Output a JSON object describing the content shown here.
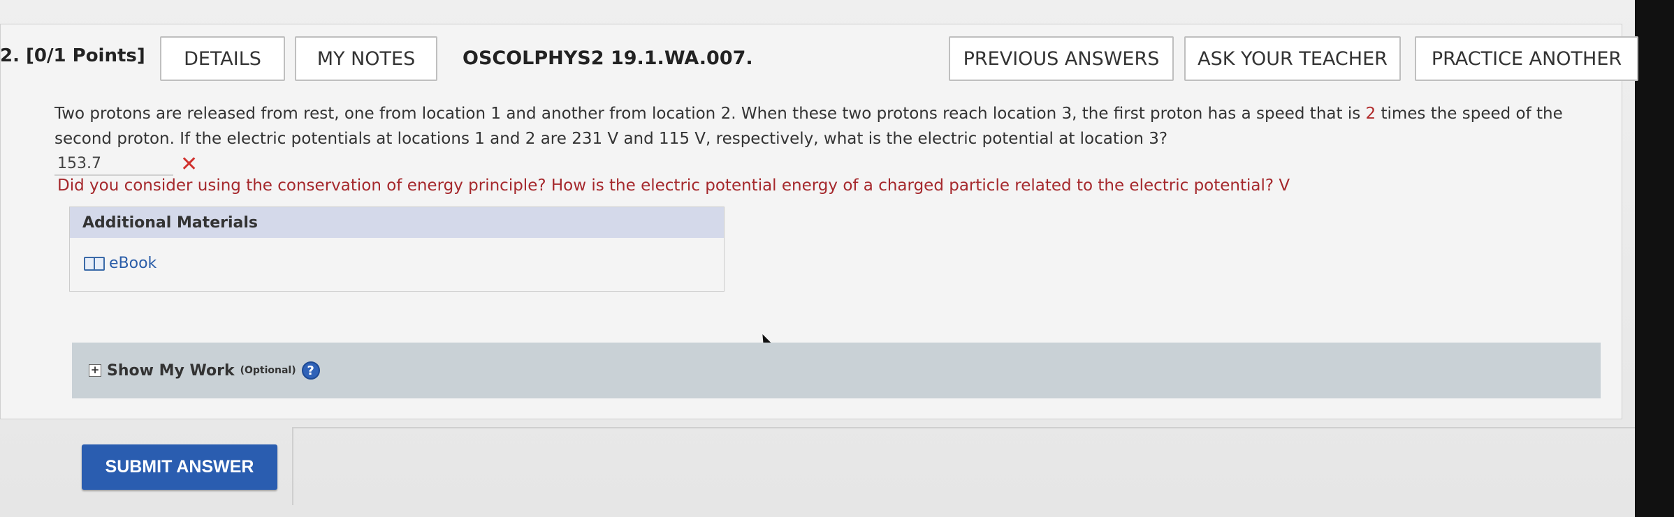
{
  "header": {
    "question_number": "2.",
    "points": "[0/1 Points]",
    "details_label": "DETAILS",
    "my_notes_label": "MY NOTES",
    "question_code": "OSCOLPHYS2 19.1.WA.007.",
    "previous_answers_label": "PREVIOUS ANSWERS",
    "ask_teacher_label": "ASK YOUR TEACHER",
    "practice_another_label": "PRACTICE ANOTHER"
  },
  "question": {
    "text_part1": "Two protons are released from rest, one from location 1 and another from location 2. When these two protons reach location 3, the first proton has a speed that is ",
    "highlight_value": "2",
    "text_part2": " times the speed of the second proton. If the electric potentials at locations 1 and 2 are 231 V and 115 V, respectively, what is the electric potential at location 3?",
    "answer_value": "153.7",
    "answer_status": "incorrect",
    "feedback": "Did you consider using the conservation of energy principle? How is the electric potential energy of a charged particle related to the electric potential? V"
  },
  "materials": {
    "header": "Additional Materials",
    "ebook_label": "eBook"
  },
  "show_work": {
    "label": "Show My Work",
    "optional": "(Optional)",
    "help": "?"
  },
  "submit": {
    "label": "SUBMIT ANSWER"
  },
  "colors": {
    "accent": "#2a5db0",
    "error": "#d0312d",
    "feedback": "#a5282c",
    "materials_header": "#d4d9ea",
    "show_work_bar": "#c9d1d6"
  }
}
